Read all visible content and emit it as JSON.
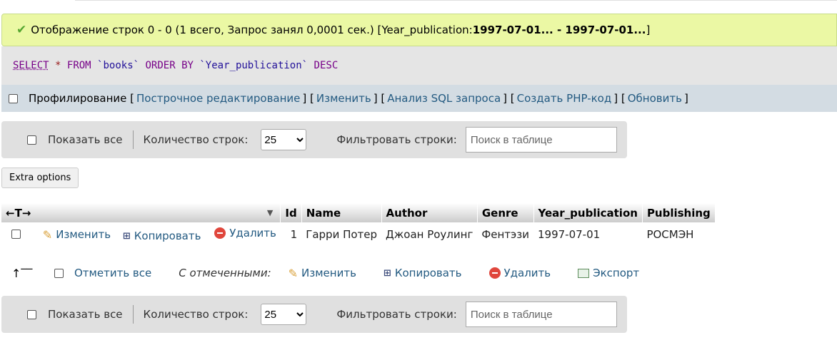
{
  "message": {
    "text": "Отображение строк 0 - 0 (1 всего, Запрос занял 0,0001 сек.) [Year_publication: ",
    "range": "1997-07-01... - 1997-07-01...",
    "close": "]"
  },
  "sql": {
    "select": "SELECT",
    "star": "*",
    "from": "FROM",
    "table": "`books`",
    "orderby": "ORDER BY",
    "column": "`Year_publication`",
    "desc": "DESC"
  },
  "profiling": {
    "label": "Профилирование",
    "links": [
      "Построчное редактирование",
      "Изменить",
      "Анализ SQL запроса",
      "Создать PHP-код",
      "Обновить"
    ]
  },
  "nav": {
    "show_all": "Показать все",
    "rows_label": "Количество строк:",
    "rows_value": "25",
    "filter_label": "Фильтровать строки:",
    "search_placeholder": "Поиск в таблице"
  },
  "extra_options": "Extra options",
  "table": {
    "arrows": "←T→",
    "columns": [
      "Id",
      "Name",
      "Author",
      "Genre",
      "Year_publication",
      "Publishing"
    ],
    "rows": [
      {
        "edit": "Изменить",
        "copy": "Копировать",
        "delete": "Удалить",
        "cells": [
          "1",
          "Гарри Потер",
          "Джоан Роулинг",
          "Фентэзи",
          "1997-07-01",
          "РОСМЭН"
        ]
      }
    ]
  },
  "bulk": {
    "check_all": "Отметить все",
    "with_selected": "С отмеченными:",
    "edit": "Изменить",
    "copy": "Копировать",
    "delete": "Удалить",
    "export": "Экспорт"
  },
  "colors": {
    "success_bg": "#ebf8a4",
    "link": "#235a81",
    "sql_bg": "#e5e5e5",
    "profiling_bg": "#d3dce3"
  }
}
